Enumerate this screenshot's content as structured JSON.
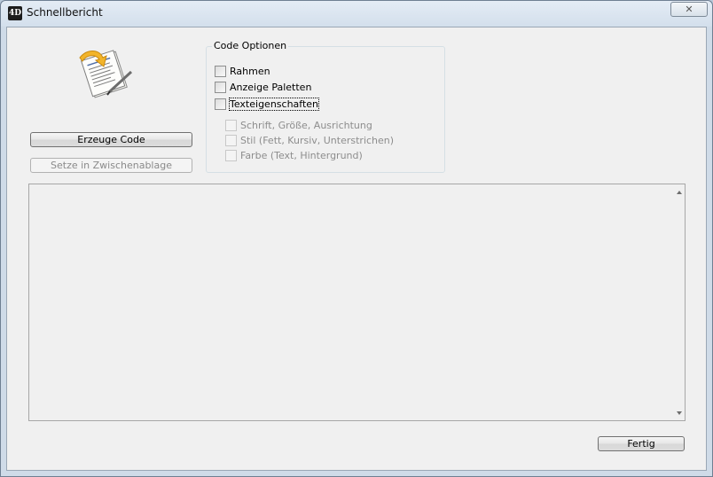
{
  "window": {
    "title": "Schnellbericht",
    "app_icon_text": "4D",
    "close_symbol": "✕"
  },
  "icons": {
    "app": "4d-app-icon",
    "report": "quick-report-document-icon",
    "close": "close-icon"
  },
  "buttons": {
    "generate": "Erzeuge Code",
    "clipboard": "Setze in Zwischenablage",
    "done": "Fertig"
  },
  "code_options": {
    "label": "Code Optionen",
    "frame": {
      "label": "Rahmen",
      "checked": false
    },
    "palettes": {
      "label": "Anzeige Paletten",
      "checked": false
    },
    "text_props": {
      "label": "Texteigenschaften",
      "checked": false
    },
    "font_size_align": {
      "label": "Schrift, Größe, Ausrichtung",
      "checked": false,
      "enabled": false
    },
    "style": {
      "label": "Stil (Fett, Kursiv, Unterstrichen)",
      "checked": false,
      "enabled": false
    },
    "color": {
      "label": "Farbe (Text, Hintergrund)",
      "checked": false,
      "enabled": false
    }
  },
  "code_output": {
    "value": ""
  }
}
